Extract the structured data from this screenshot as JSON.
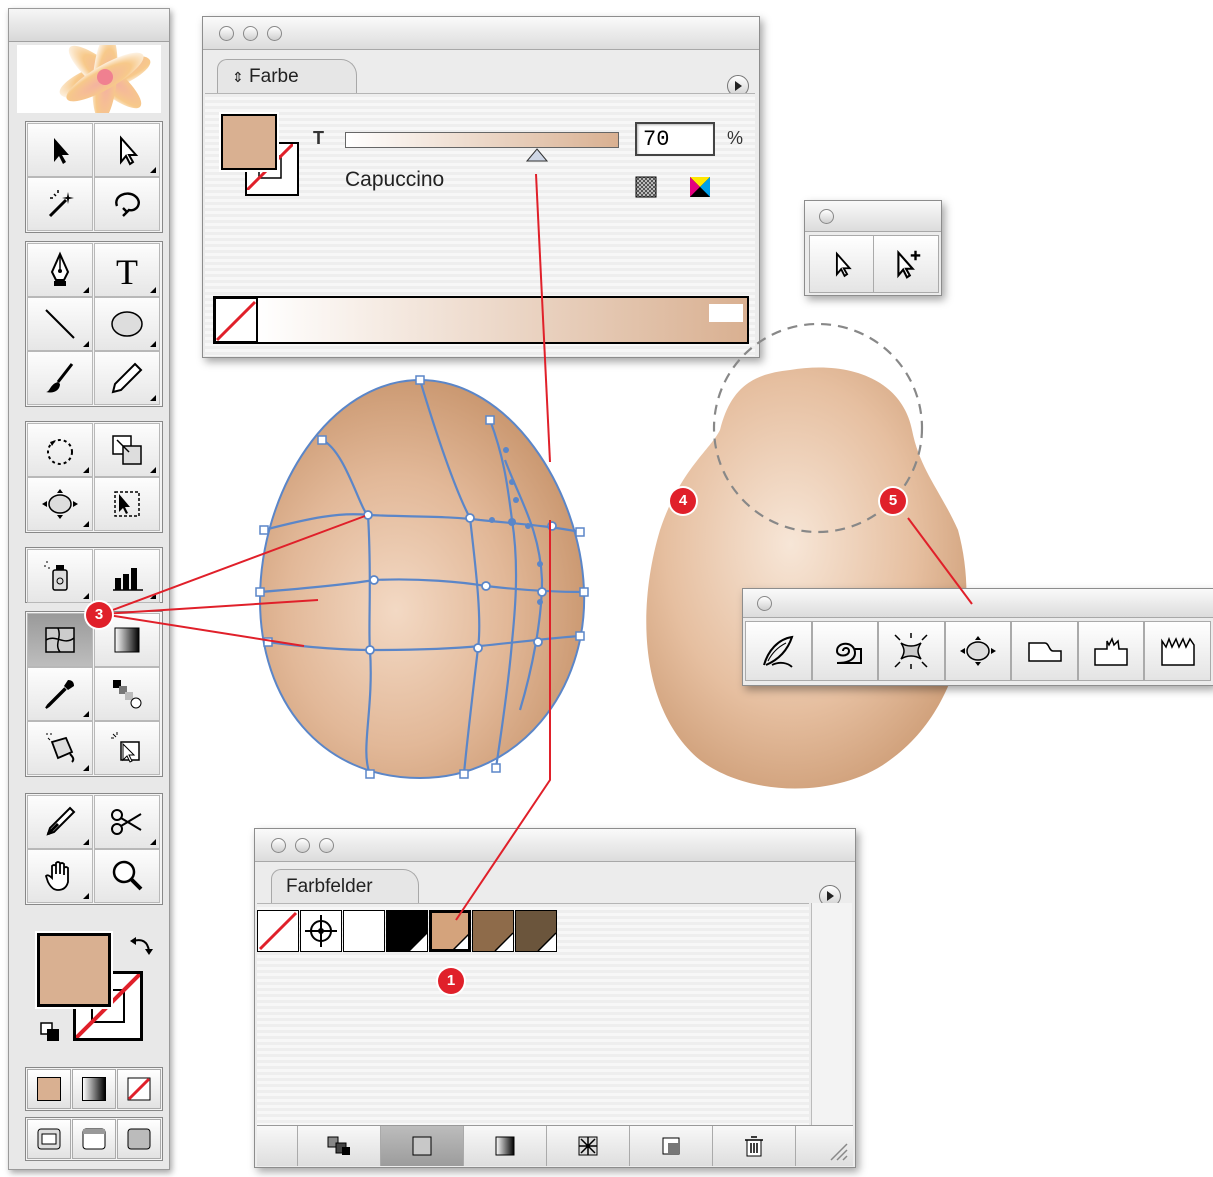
{
  "color_panel": {
    "tab_label": "Farbe",
    "tint_label": "T",
    "tint_value": "70",
    "percent_symbol": "%",
    "swatch_name": "Capuccino",
    "tint_fraction": 0.7,
    "fill_color": "#d9b091"
  },
  "swatches_panel": {
    "tab_label": "Farbfelder",
    "swatch_colors": [
      "none",
      "registration",
      "#ffffff",
      "#000000",
      "#d4a37c",
      "#8e6b4a",
      "#6b553c"
    ]
  },
  "toolbox": {
    "fill_color": "#d9b091"
  },
  "callouts": {
    "c1": "1",
    "c3": "3",
    "c4": "4",
    "c5": "5"
  },
  "colors": {
    "accent_red": "#e0202a",
    "egg_light": "#f3d9c4",
    "egg_dark": "#c8956d",
    "mesh_line": "#5b86c8"
  }
}
